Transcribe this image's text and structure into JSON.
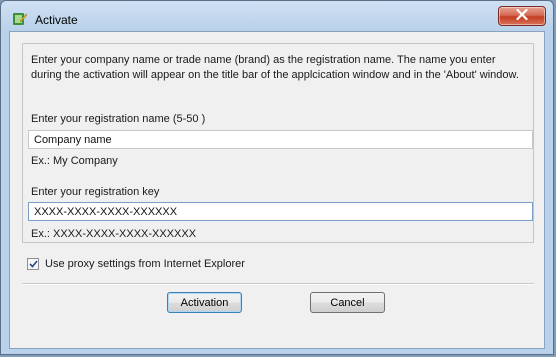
{
  "window": {
    "title": "Activate",
    "app_icon": "key-app-icon",
    "close_icon": "close-icon",
    "close_color": "#c33d22"
  },
  "form": {
    "description": "Enter your company name or trade name (brand) as the registration name. The name you enter during the activation will appear on the title bar of the applcication window and in the 'About' window.",
    "name_label": "Enter your registration name (5-50 )",
    "name_value": "Company name",
    "name_example": "Ex.: My Company",
    "key_label": "Enter your registration key",
    "key_value": "XXXX-XXXX-XXXX-XXXXXX",
    "key_example": "Ex.: XXXX-XXXX-XXXX-XXXXXX"
  },
  "proxy": {
    "label": "Use proxy settings from Internet Explorer",
    "checked": true
  },
  "buttons": {
    "activation": "Activation",
    "cancel": "Cancel"
  }
}
